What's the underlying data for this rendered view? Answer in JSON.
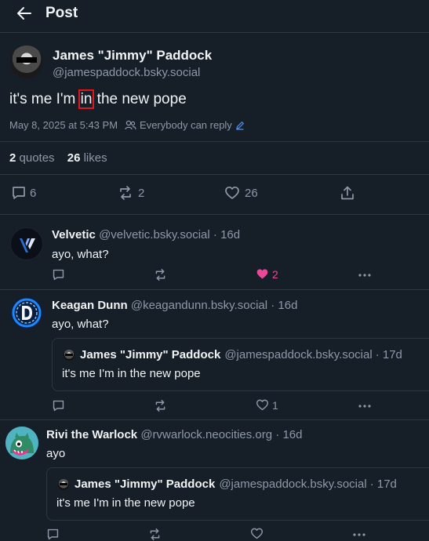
{
  "header": {
    "title": "Post"
  },
  "main_post": {
    "author_name": "James \"Jimmy\" Paddock",
    "author_handle": "@jamespaddock.bsky.social",
    "text_before": "it's me I'm ",
    "text_highlight": "in",
    "text_after": " the new pope",
    "timestamp": "May 8, 2025 at 5:43 PM",
    "reply_setting": "Everybody can reply",
    "quotes_count": "2",
    "quotes_label": "quotes",
    "likes_count": "26",
    "likes_label": "likes",
    "replies": "6",
    "reposts": "2",
    "likes": "26"
  },
  "replies": [
    {
      "name": "Velvetic",
      "handle": "@velvetic.bsky.social",
      "age": "· 16d",
      "text": "ayo, what?",
      "likes": "2"
    },
    {
      "name": "Keagan Dunn",
      "handle": "@keagandunn.bsky.social",
      "age": "· 16d",
      "text": "ayo, what?",
      "likes": "1",
      "quote": {
        "name": "James \"Jimmy\" Paddock",
        "handle": "@jamespaddock.bsky.social",
        "age": "· 17d",
        "text": "it's me I'm in the new pope"
      }
    },
    {
      "name": "Rivi the Warlock",
      "handle": "@rvwarlock.neocities.org",
      "age": "· 16d",
      "text": "ayo",
      "quote": {
        "name": "James \"Jimmy\" Paddock",
        "handle": "@jamespaddock.bsky.social",
        "age": "· 17d",
        "text": "it's me I'm in the new pope"
      }
    }
  ],
  "colors": {
    "background": "#161e27",
    "muted": "#8d99a9",
    "like_active": "#ec4899",
    "highlight_box": "#e0171c",
    "link": "#4a8ff5"
  }
}
